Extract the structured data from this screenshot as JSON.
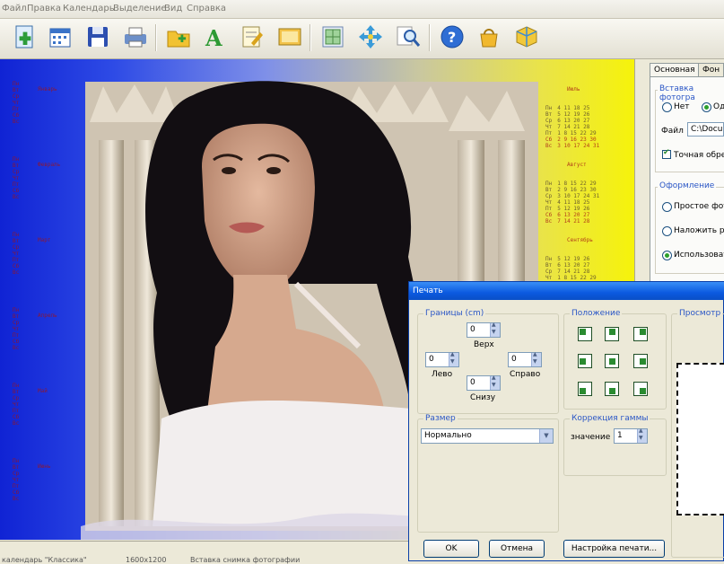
{
  "menu": [
    "Файл",
    "Правка",
    "Календарь",
    "Выделение",
    "Вид",
    "Справка"
  ],
  "toolbar": {
    "icons": [
      "add-photo-icon",
      "calendar-icon",
      "save-icon",
      "print-icon",
      "open-folder-icon",
      "text-icon",
      "edit-icon",
      "image-icon",
      "layout-icon",
      "move-icon",
      "zoom-icon",
      "help-icon",
      "shop-icon",
      "box-icon"
    ]
  },
  "calendars": {
    "left_months": [
      "Январь",
      "Февраль",
      "Март",
      "Апрель",
      "Май",
      "Июнь"
    ],
    "right_months": [
      "Июль",
      "Август",
      "Сентябрь"
    ],
    "weekdays": [
      "Пн",
      "Вт",
      "Ср",
      "Чт",
      "Пт",
      "Сб",
      "Вс"
    ],
    "right_sample_rows": [
      "4 11 18 25",
      "5 12 19 26",
      "6 13 20 27",
      "7 14 21 28",
      "1 8 15 22 29",
      "2 9 16 23 30",
      "3 10 17 24 31"
    ],
    "august_rows": [
      "1 8 15 22 29",
      "2 9 16 23 30",
      "3 10 17 24 31",
      "4 11 18 25",
      "5 12 19 26",
      "6 13 20 27",
      "7 14 21 28"
    ],
    "september_rows": [
      "5 12 19 26",
      "6 13 20 27",
      "7 14 21 28",
      "1 8 15 22 29",
      "2 9 16 23 30",
      "3 10 17 24",
      "4 11 18 25"
    ]
  },
  "right_panel": {
    "tabs": [
      "Основная",
      "Фон"
    ],
    "photo_group_title": "Вставка фотогра",
    "radio_no": "Нет",
    "radio_one": "Од",
    "file_label": "Файл",
    "file_value": "C:\\Docu",
    "exact_checkbox": "Точная обрез",
    "design_group_title": "Оформление",
    "opt_simple": "Простое фото",
    "opt_overlay": "Наложить ра",
    "opt_use": "Использовати"
  },
  "dialog": {
    "title": "Печать",
    "margins_title": "Границы (cm)",
    "top_label": "Верх",
    "top_value": "0",
    "left_label": "Лево",
    "left_value": "0",
    "right_label": "Справо",
    "right_value": "0",
    "bottom_label": "Снизу",
    "bottom_value": "0",
    "position_title": "Положение",
    "preview_title": "Просмотр",
    "size_title": "Размер",
    "size_value": "Нормально",
    "gamma_title": "Коррекция гаммы",
    "gamma_label": "значение",
    "gamma_value": "1",
    "ok": "OK",
    "cancel": "Отмена",
    "setup": "Настройка печати..."
  },
  "status": {
    "text1": "календарь \"Классика\"",
    "text2": "1600x1200",
    "text3": "Вставка снимка фотографии"
  },
  "colors": {
    "accent": "#0b5ae0",
    "calendar_text": "#a31212",
    "position_icon": "#2a8b30"
  }
}
